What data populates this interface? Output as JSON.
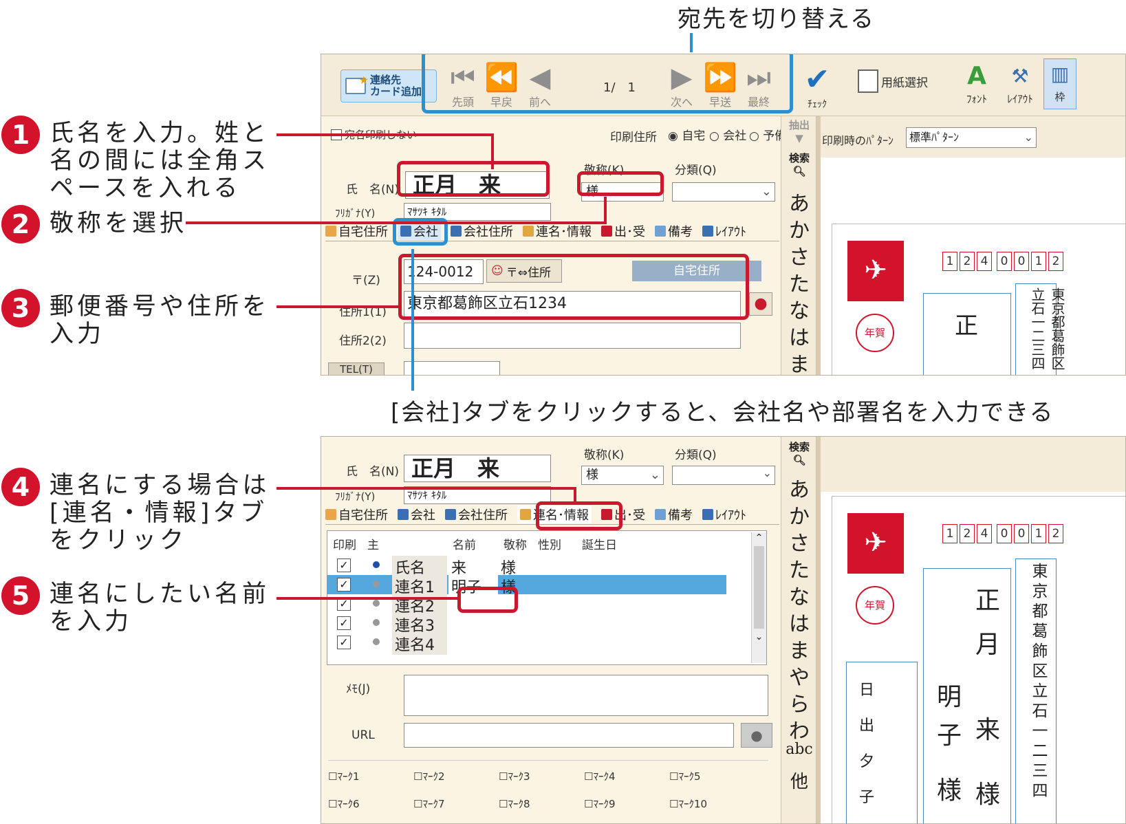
{
  "top_caption": "宛先を切り替える",
  "middle_caption": "[会社]タブをクリックすると、会社名や部署名を入力できる",
  "steps": [
    {
      "num": "1",
      "text": "氏名を入力。姓と名の間には全角スペースを入れる",
      "lines": [
        "氏名を入力。姓と",
        "名の間には全角ス",
        "ペースを入れる"
      ]
    },
    {
      "num": "2",
      "text": "敬称を選択",
      "lines": [
        "敬称を選択"
      ]
    },
    {
      "num": "3",
      "text": "郵便番号や住所を入力",
      "lines": [
        "郵便番号や住所を",
        "入力"
      ]
    },
    {
      "num": "4",
      "text": "連名にする場合は[連名・情報]タブをクリック",
      "lines": [
        "連名にする場合は",
        "[連名・情報]タブ",
        "をクリック"
      ]
    },
    {
      "num": "5",
      "text": "連名にしたい名前を入力",
      "lines": [
        "連名にしたい名前",
        "を入力"
      ]
    }
  ],
  "toolbar": {
    "add_card": [
      "連絡先",
      "カード追加"
    ],
    "nav": {
      "first": "先頭",
      "fast_back": "早戻",
      "prev": "前へ",
      "counter": "1/　1",
      "next": "次へ",
      "fast_forward": "早送",
      "last": "最終"
    },
    "check": "ﾁｪｯｸ",
    "paper_select": "用紙選択",
    "font": "ﾌｫﾝﾄ",
    "layout": "ﾚｲｱｳﾄ",
    "frame": "枠"
  },
  "form": {
    "no_print_label": "宛名印刷しない",
    "print_address_label": "印刷住所",
    "print_address_options": [
      "自宅",
      "会社",
      "予備"
    ],
    "print_address_selected": "自宅",
    "name_label": "氏　名(N)",
    "name_value": "正月　来",
    "furigana_label": "ﾌﾘｶﾞﾅ(Y)",
    "furigana_value": "ﾏｻﾂｷ ｷﾀﾙ",
    "honorific_label": "敬称(K)",
    "honorific_value": "様",
    "category_label": "分類(Q)",
    "category_value": "",
    "tabs": [
      "自宅住所",
      "会社",
      "会社住所",
      "連名･情報",
      "出･受",
      "備考",
      "ﾚｲｱｳﾄ"
    ],
    "postal_label": "〒(Z)",
    "postal_value": "124-0012",
    "postal_button": "〒⇔住所",
    "address_type_badge": "自宅住所",
    "address1_label": "住所1(1)",
    "address1_value": "東京都葛飾区立石1234",
    "address2_label": "住所2(2)",
    "address2_value": "",
    "tel_label": "TEL(T)"
  },
  "side": {
    "extract": "抽出",
    "search": "検索",
    "kana_top": [
      "あ",
      "か",
      "さ",
      "た",
      "な",
      "は",
      "ま"
    ],
    "kana_bottom": [
      "あ",
      "か",
      "さ",
      "た",
      "な",
      "は",
      "ま",
      "や",
      "ら",
      "わ",
      "abc",
      "他"
    ]
  },
  "preview": {
    "pattern_label": "印刷時のﾊﾟﾀｰﾝ",
    "pattern_value": "標準ﾊﾟﾀｰﾝ",
    "postal_digits": [
      "1",
      "2",
      "4",
      "0",
      "0",
      "1",
      "2"
    ],
    "stamp_text": "年賀",
    "address_vertical": "東京都葛飾区立石一二三四",
    "name_top": "正",
    "name_bottom": [
      "正",
      "月",
      "来",
      "様"
    ],
    "rename": [
      "明",
      "子",
      "様"
    ],
    "sender": [
      "日",
      "出",
      "夕",
      "子"
    ]
  },
  "renmei": {
    "headers": [
      "印刷",
      "主",
      "",
      "名前",
      "敬称",
      "性別",
      "誕生日"
    ],
    "rows": [
      {
        "label": "氏名",
        "name": "来",
        "honorific": "様"
      },
      {
        "label": "連名1",
        "name": "明子",
        "honorific": "様"
      },
      {
        "label": "連名2",
        "name": "",
        "honorific": ""
      },
      {
        "label": "連名3",
        "name": "",
        "honorific": ""
      },
      {
        "label": "連名4",
        "name": "",
        "honorific": ""
      }
    ],
    "memo_label": "ﾒﾓ(J)",
    "url_label": "URL",
    "marks": [
      "ﾏｰｸ1",
      "ﾏｰｸ2",
      "ﾏｰｸ3",
      "ﾏｰｸ4",
      "ﾏｰｸ5",
      "ﾏｰｸ6",
      "ﾏｰｸ7",
      "ﾏｰｸ8",
      "ﾏｰｸ9",
      "ﾏｰｸ10"
    ]
  }
}
